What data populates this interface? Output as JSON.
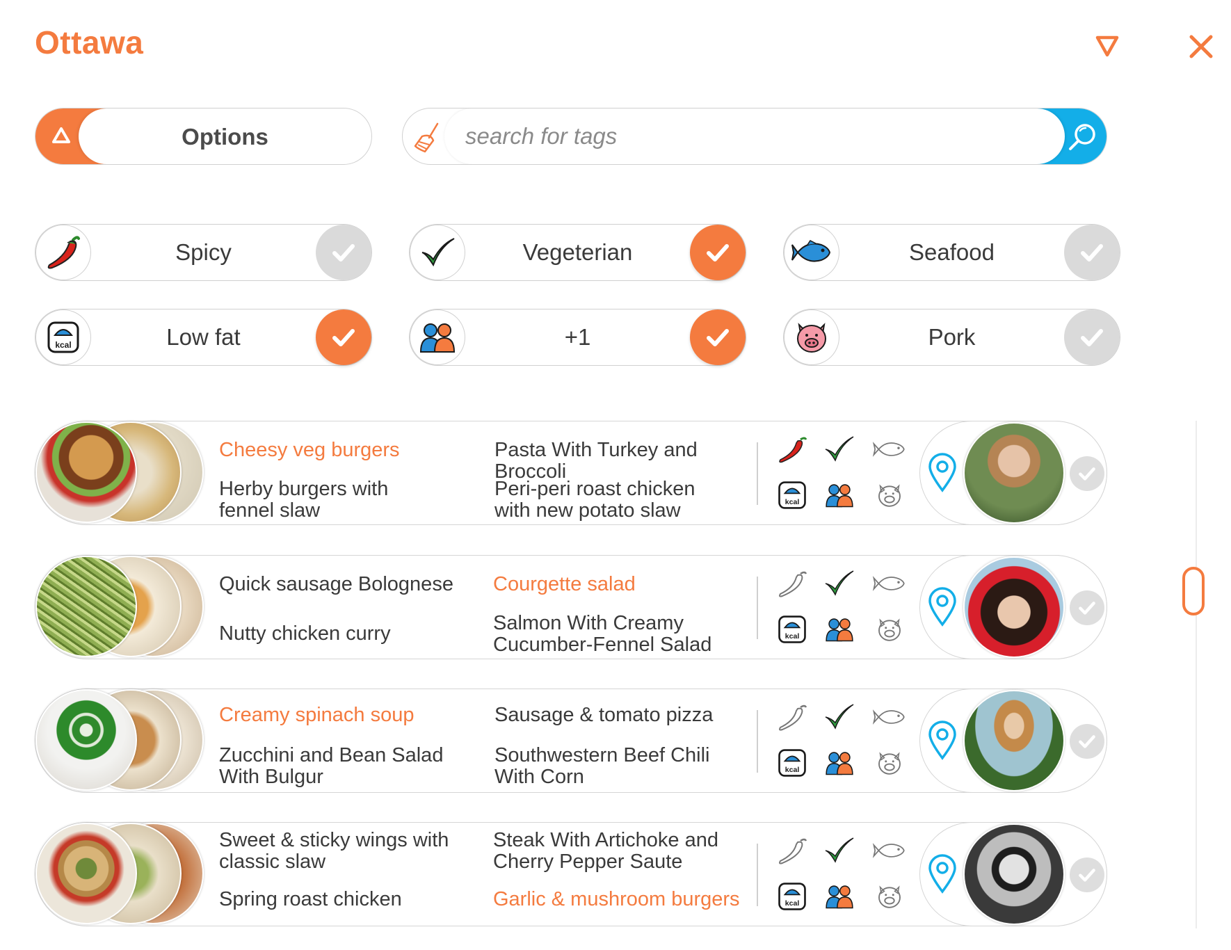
{
  "header": {
    "title": "Ottawa",
    "filter_icon": "filter-icon",
    "close_icon": "close-icon",
    "accent": "#f47b3f",
    "blue_accent": "#13aee8"
  },
  "options": {
    "label": "Options",
    "icon": "triangle-up-icon"
  },
  "search": {
    "placeholder": "search for tags",
    "value": "",
    "clear_icon": "broom-icon",
    "search_icon": "magnifier-icon"
  },
  "filters": [
    {
      "label": "Spicy",
      "icon": "chili-icon",
      "checked": false
    },
    {
      "label": "Vegeterian",
      "icon": "leaf-check-icon",
      "checked": true
    },
    {
      "label": "Seafood",
      "icon": "fish-icon",
      "checked": false
    },
    {
      "label": "Low fat",
      "icon": "kcal-scale-icon",
      "checked": true
    },
    {
      "label": "+1",
      "icon": "people-icon",
      "checked": true
    },
    {
      "label": "Pork",
      "icon": "pig-icon",
      "checked": false
    }
  ],
  "rows": [
    {
      "recipes": [
        {
          "name": "Cheesy veg burgers",
          "highlight": true
        },
        {
          "name": "Pasta With Turkey and Broccoli",
          "highlight": false
        },
        {
          "name": "Herby burgers with fennel slaw",
          "highlight": false
        },
        {
          "name": "Peri-peri roast chicken with new potato slaw",
          "highlight": false
        }
      ],
      "tags": {
        "spicy": true,
        "vegetarian": true,
        "seafood": false,
        "low_fat": true,
        "plus_one": true,
        "pork": false
      }
    },
    {
      "recipes": [
        {
          "name": "Quick sausage Bolognese",
          "highlight": false
        },
        {
          "name": "Courgette salad",
          "highlight": true
        },
        {
          "name": "Nutty chicken curry",
          "highlight": false
        },
        {
          "name": "Salmon With Creamy Cucumber-Fennel Salad",
          "highlight": false
        }
      ],
      "tags": {
        "spicy": false,
        "vegetarian": true,
        "seafood": false,
        "low_fat": true,
        "plus_one": true,
        "pork": false
      }
    },
    {
      "recipes": [
        {
          "name": "Creamy spinach soup",
          "highlight": true
        },
        {
          "name": "Sausage & tomato pizza",
          "highlight": false
        },
        {
          "name": "Zucchini and Bean Salad With Bulgur",
          "highlight": false
        },
        {
          "name": "Southwestern Beef Chili With Corn",
          "highlight": false
        }
      ],
      "tags": {
        "spicy": false,
        "vegetarian": true,
        "seafood": false,
        "low_fat": true,
        "plus_one": true,
        "pork": false
      }
    },
    {
      "recipes": [
        {
          "name": "Sweet & sticky wings with classic slaw",
          "highlight": false
        },
        {
          "name": "Steak With Artichoke and Cherry Pepper Saute",
          "highlight": false
        },
        {
          "name": "Spring roast chicken",
          "highlight": false
        },
        {
          "name": "Garlic & mushroom burgers",
          "highlight": true
        }
      ],
      "tags": {
        "spicy": false,
        "vegetarian": true,
        "seafood": false,
        "low_fat": true,
        "plus_one": true,
        "pork": false
      }
    }
  ]
}
